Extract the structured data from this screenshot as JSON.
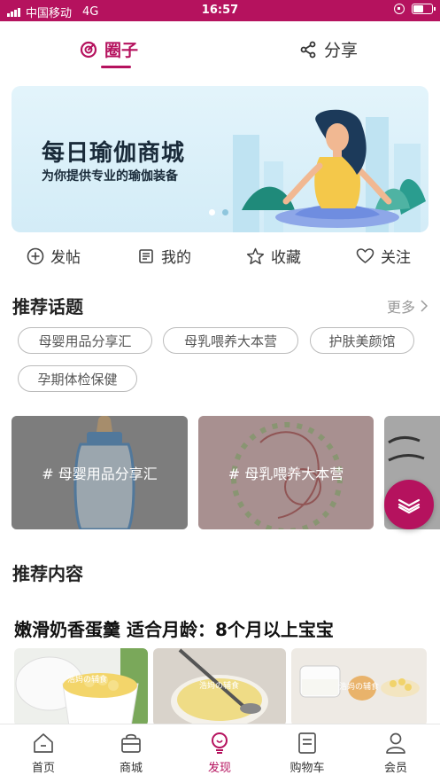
{
  "status_bar": {
    "carrier": "中国移动",
    "network": "4G",
    "time": "16:57"
  },
  "top_tabs": [
    {
      "label": "圈子",
      "active": true,
      "icon": "circle-target-icon"
    },
    {
      "label": "分享",
      "active": false,
      "icon": "share-icon"
    }
  ],
  "banner": {
    "title": "每日瑜伽商城",
    "subtitle": "为你提供专业的瑜伽装备",
    "slide_count": 2,
    "active_slide": 1
  },
  "actions": [
    {
      "label": "发帖",
      "icon": "plus-circle-icon"
    },
    {
      "label": "我的",
      "icon": "document-icon"
    },
    {
      "label": "收藏",
      "icon": "star-icon"
    },
    {
      "label": "关注",
      "icon": "heart-icon"
    }
  ],
  "topics_section": {
    "title": "推荐话题",
    "more_label": "更多",
    "chips": [
      "母婴用品分享汇",
      "母乳喂养大本营",
      "护肤美颜馆",
      "孕期体检保健"
    ]
  },
  "topic_cards": [
    {
      "caption": "# 母婴用品分享汇"
    },
    {
      "caption": "# 母乳喂养大本营"
    },
    {
      "caption": ""
    }
  ],
  "content_section": {
    "title": "推荐内容"
  },
  "article": {
    "title": "嫩滑奶香蛋羹 适合月龄：8个月以上宝宝",
    "thumb_watermark": "浩妈の辅食"
  },
  "bottom_nav": [
    {
      "label": "首页",
      "icon": "home-icon",
      "active": false
    },
    {
      "label": "商城",
      "icon": "shopping-bag-icon",
      "active": false
    },
    {
      "label": "发现",
      "icon": "lightbulb-icon",
      "active": true
    },
    {
      "label": "购物车",
      "icon": "cart-list-icon",
      "active": false
    },
    {
      "label": "会员",
      "icon": "user-icon",
      "active": false
    }
  ],
  "colors": {
    "brand": "#b5125e",
    "muted": "#999999"
  }
}
